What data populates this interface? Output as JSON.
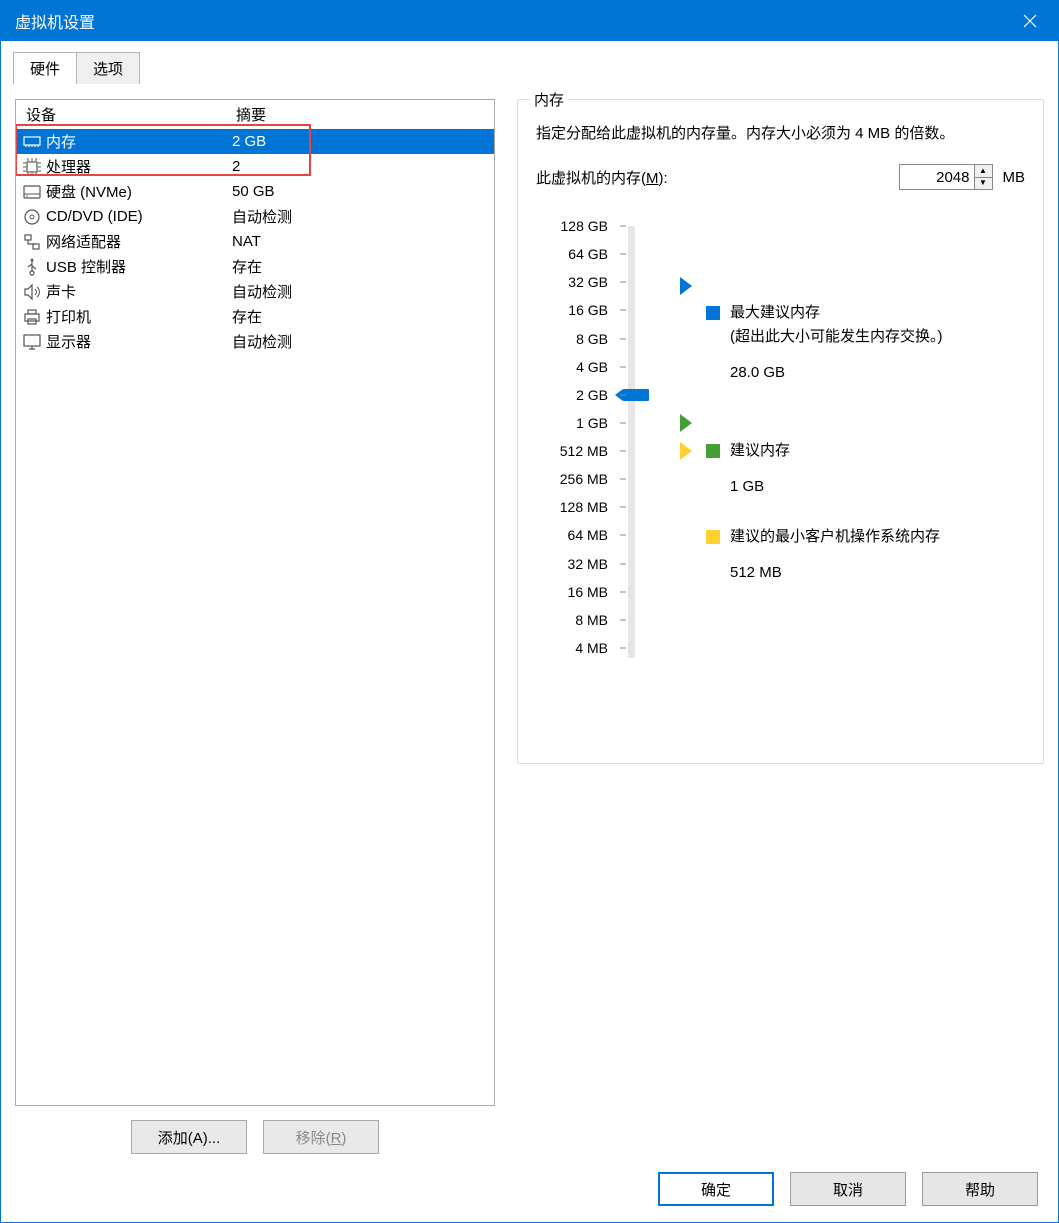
{
  "title": "虚拟机设置",
  "tabs": {
    "hardware": "硬件",
    "options": "选项"
  },
  "device_header": {
    "device": "设备",
    "summary": "摘要"
  },
  "devices": [
    {
      "icon": "memory-icon",
      "name": "内存",
      "summary": "2 GB",
      "selected": true
    },
    {
      "icon": "cpu-icon",
      "name": "处理器",
      "summary": "2"
    },
    {
      "icon": "disk-icon",
      "name": "硬盘 (NVMe)",
      "summary": "50 GB"
    },
    {
      "icon": "cd-icon",
      "name": "CD/DVD (IDE)",
      "summary": "自动检测"
    },
    {
      "icon": "network-icon",
      "name": "网络适配器",
      "summary": "NAT"
    },
    {
      "icon": "usb-icon",
      "name": "USB 控制器",
      "summary": "存在"
    },
    {
      "icon": "sound-icon",
      "name": "声卡",
      "summary": "自动检测"
    },
    {
      "icon": "printer-icon",
      "name": "打印机",
      "summary": "存在"
    },
    {
      "icon": "display-icon",
      "name": "显示器",
      "summary": "自动检测"
    }
  ],
  "left_buttons": {
    "add": "添加(A)...",
    "remove": "移除(R)"
  },
  "memory_group": {
    "title": "内存",
    "description": "指定分配给此虚拟机的内存量。内存大小必须为 4 MB 的倍数。",
    "input_label_prefix": "此虚拟机的内存(",
    "input_label_key": "M",
    "input_label_suffix": "):",
    "value": "2048",
    "unit": "MB",
    "ticks": [
      "128 GB",
      "64 GB",
      "32 GB",
      "16 GB",
      "8 GB",
      "4 GB",
      "2 GB",
      "1 GB",
      "512 MB",
      "256 MB",
      "128 MB",
      "64 MB",
      "32 MB",
      "16 MB",
      "8 MB",
      "4 MB"
    ],
    "legend": {
      "max": {
        "title": "最大建议内存",
        "note": "(超出此大小可能发生内存交换。)",
        "value": "28.0 GB"
      },
      "rec": {
        "title": "建议内存",
        "value": "1 GB"
      },
      "min": {
        "title": "建议的最小客户机操作系统内存",
        "value": "512 MB"
      }
    }
  },
  "dialog_buttons": {
    "ok": "确定",
    "cancel": "取消",
    "help": "帮助"
  }
}
